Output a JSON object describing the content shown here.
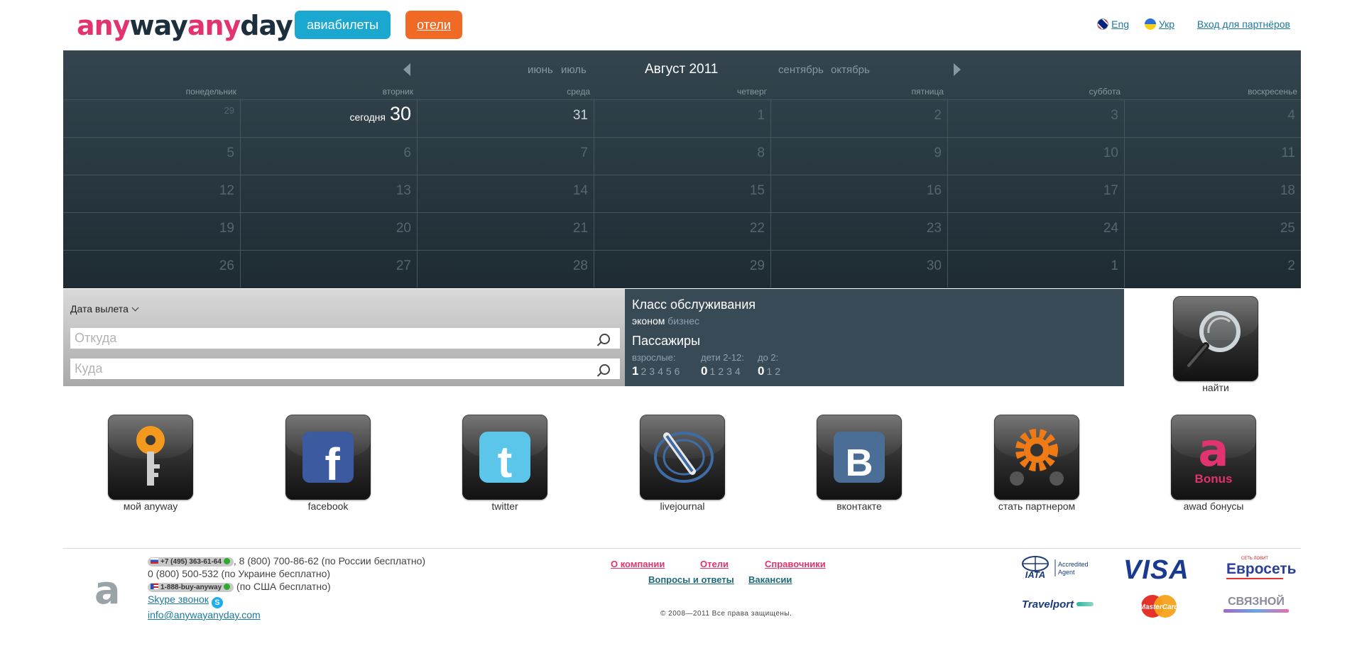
{
  "header": {
    "logo_part1": "any",
    "logo_part2": "way",
    "logo_part3": "any",
    "logo_part4": "day",
    "tab_flights": "авиабилеты",
    "tab_hotels": "отели",
    "lang_eng": "Eng",
    "lang_ukr": "Укр",
    "partner_login": "Вход для партнёров"
  },
  "calendar": {
    "current_month": "Август 2011",
    "prev_months": [
      "июнь",
      "июль"
    ],
    "next_months": [
      "сентябрь",
      "октябрь"
    ],
    "weekdays": [
      "понедельник",
      "вторник",
      "среда",
      "четверг",
      "пятница",
      "суббота",
      "воскресенье"
    ],
    "today_label": "сегодня",
    "weeks": [
      [
        "29",
        "30",
        "31",
        "1",
        "2",
        "3",
        "4"
      ],
      [
        "5",
        "6",
        "7",
        "8",
        "9",
        "10",
        "11"
      ],
      [
        "12",
        "13",
        "14",
        "15",
        "16",
        "17",
        "18"
      ],
      [
        "19",
        "20",
        "21",
        "22",
        "23",
        "24",
        "25"
      ],
      [
        "26",
        "27",
        "28",
        "29",
        "30",
        "1",
        "2"
      ]
    ]
  },
  "search": {
    "date_dropdown": "Дата вылета",
    "from_placeholder": "Откуда",
    "to_placeholder": "Куда",
    "class_title": "Класс обслуживания",
    "class_selected": "эконом",
    "class_other": "бизнес",
    "passengers_title": "Пассажиры",
    "adults_label": "взрослые:",
    "children_label": "дети 2-12:",
    "infants_label": "до 2:",
    "adults_selected": "1",
    "adults_options": [
      "2",
      "3",
      "4",
      "5",
      "6"
    ],
    "children_selected": "0",
    "children_options": [
      "1",
      "2",
      "3",
      "4"
    ],
    "infants_selected": "0",
    "infants_options": [
      "1",
      "2"
    ],
    "find_label": "найти"
  },
  "apps": [
    {
      "label": "мой anyway",
      "icon": "key-icon"
    },
    {
      "label": "facebook",
      "icon": "facebook-icon"
    },
    {
      "label": "twitter",
      "icon": "twitter-icon"
    },
    {
      "label": "livejournal",
      "icon": "livejournal-icon"
    },
    {
      "label": "вконтакте",
      "icon": "vkontakte-icon"
    },
    {
      "label": "стать партнером",
      "icon": "gear-icon"
    },
    {
      "label": "awad бонусы",
      "icon": "bonus-icon"
    }
  ],
  "bonus_text": "Bonus",
  "footer": {
    "logo_letter": "a",
    "phone_ru_badge": "+7 (495) 363-61-64",
    "phone_ru_rest": ", 8 (800) 700-86-62 (по России бесплатно)",
    "phone_ua": "0 (800) 500-532 (по Украине бесплатно)",
    "phone_us_badge": "1-888-buy-anyway",
    "phone_us_rest": " (по США бесплатно)",
    "skype": "Skype звонок",
    "email": "info@anywayanyday.com",
    "link_company": "О компании",
    "link_hotels": "Отели",
    "link_reference": "Справочники",
    "link_faq": "Вопросы и ответы",
    "link_jobs": "Вакансии",
    "copyright": "© 2008—2011 Все права защищены.",
    "partners": {
      "iata": "IATA",
      "iata_sub1": "Accredited",
      "iata_sub2": "Agent",
      "visa": "VISA",
      "euroset": "Евросеть",
      "euroset_sub": "СЕТЬ ЛОВИТ",
      "travelport": "Travelport",
      "mastercard": "MasterCard",
      "svyaznoy": "СВЯЗНОЙ"
    }
  },
  "colors": {
    "brand_pink": "#e0336f",
    "brand_dark": "#1d2f3c",
    "flights_tab": "#1aa7d0",
    "hotels_tab": "#f06a25",
    "calendar_bg": "#2b3b44",
    "panel_right": "#384a55"
  }
}
